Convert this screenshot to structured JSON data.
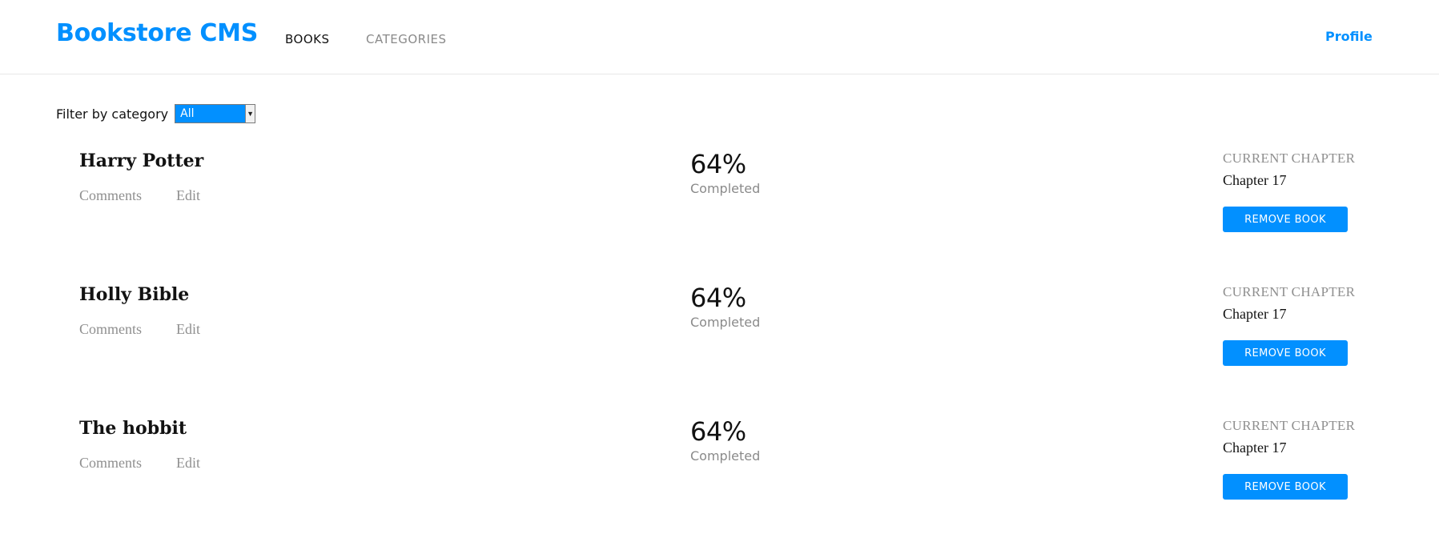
{
  "header": {
    "logo": "Bookstore CMS",
    "nav": [
      "BOOKS",
      "CATEGORIES"
    ],
    "profile": "Profile"
  },
  "filter": {
    "label": "Filter by category",
    "selected": "All"
  },
  "books": [
    {
      "title": "Harry Potter",
      "comments_label": "Comments",
      "edit_label": "Edit",
      "percent": "64%",
      "completed_label": "Completed",
      "chapter_label": "CURRENT CHAPTER",
      "chapter": "Chapter 17",
      "remove_label": "REMOVE BOOK"
    },
    {
      "title": "Holly Bible",
      "comments_label": "Comments",
      "edit_label": "Edit",
      "percent": "64%",
      "completed_label": "Completed",
      "chapter_label": "CURRENT CHAPTER",
      "chapter": "Chapter 17",
      "remove_label": "REMOVE BOOK"
    },
    {
      "title": "The hobbit",
      "comments_label": "Comments",
      "edit_label": "Edit",
      "percent": "64%",
      "completed_label": "Completed",
      "chapter_label": "CURRENT CHAPTER",
      "chapter": "Chapter 17",
      "remove_label": "REMOVE BOOK"
    }
  ],
  "colors": {
    "accent": "#0290ff",
    "text": "#121212",
    "muted": "#8a8a8a"
  }
}
